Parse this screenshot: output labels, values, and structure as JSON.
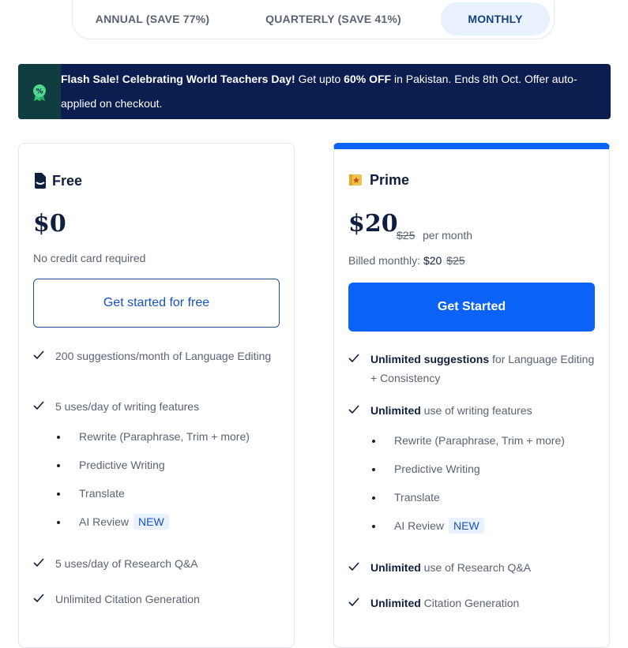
{
  "billing_toggle": {
    "annual": "ANNUAL (SAVE 77%)",
    "quarterly": "QUARTERLY (SAVE 41%)",
    "monthly": "MONTHLY",
    "selected": "monthly",
    "selected_bg": "#e8f1fd"
  },
  "banner": {
    "title": "Flash Sale! Celebrating World Teachers Day!",
    "text_before": " Get upto ",
    "discount": "60% OFF",
    "text_after": " in Pakistan. Ends 8th Oct. Offer auto-applied on checkout.",
    "icon": "discount-badge-icon",
    "bg_color": "#0c1d4f"
  },
  "plans": {
    "free": {
      "name": "Free",
      "icon": "document-icon",
      "price": "$0",
      "note": "No credit card required",
      "cta": "Get started for free",
      "features": {
        "f1": "200 suggestions/month of Language Editing",
        "f2": "5 uses/day of writing features",
        "sub1": "Rewrite (Paraphrase, Trim + more)",
        "sub2": "Predictive Writing",
        "sub3": "Translate",
        "sub4": "AI Review",
        "new": "NEW",
        "f3": "5 uses/day of Research Q&A",
        "f4": "Unlimited Citation Generation"
      }
    },
    "prime": {
      "name": "Prime",
      "icon": "star-ticket-icon",
      "price": "$20",
      "old_price": "$25",
      "per": "per month",
      "billed_label": "Billed monthly: ",
      "billed_amount": "$20",
      "billed_old": "$25",
      "cta": "Get Started",
      "accent": "#0a63f6",
      "features": {
        "f1_bold": "Unlimited suggestions",
        "f1_rest": " for Language Editing + Consistency",
        "f2_bold": "Unlimited",
        "f2_rest": " use of writing features",
        "sub1": "Rewrite (Paraphrase, Trim + more)",
        "sub2": "Predictive Writing",
        "sub3": "Translate",
        "sub4": "AI Review",
        "new": "NEW",
        "f3_bold": "Unlimited",
        "f3_rest": " use of Research Q&A",
        "f4_bold": "Unlimited",
        "f4_rest": " Citation Generation"
      }
    }
  }
}
